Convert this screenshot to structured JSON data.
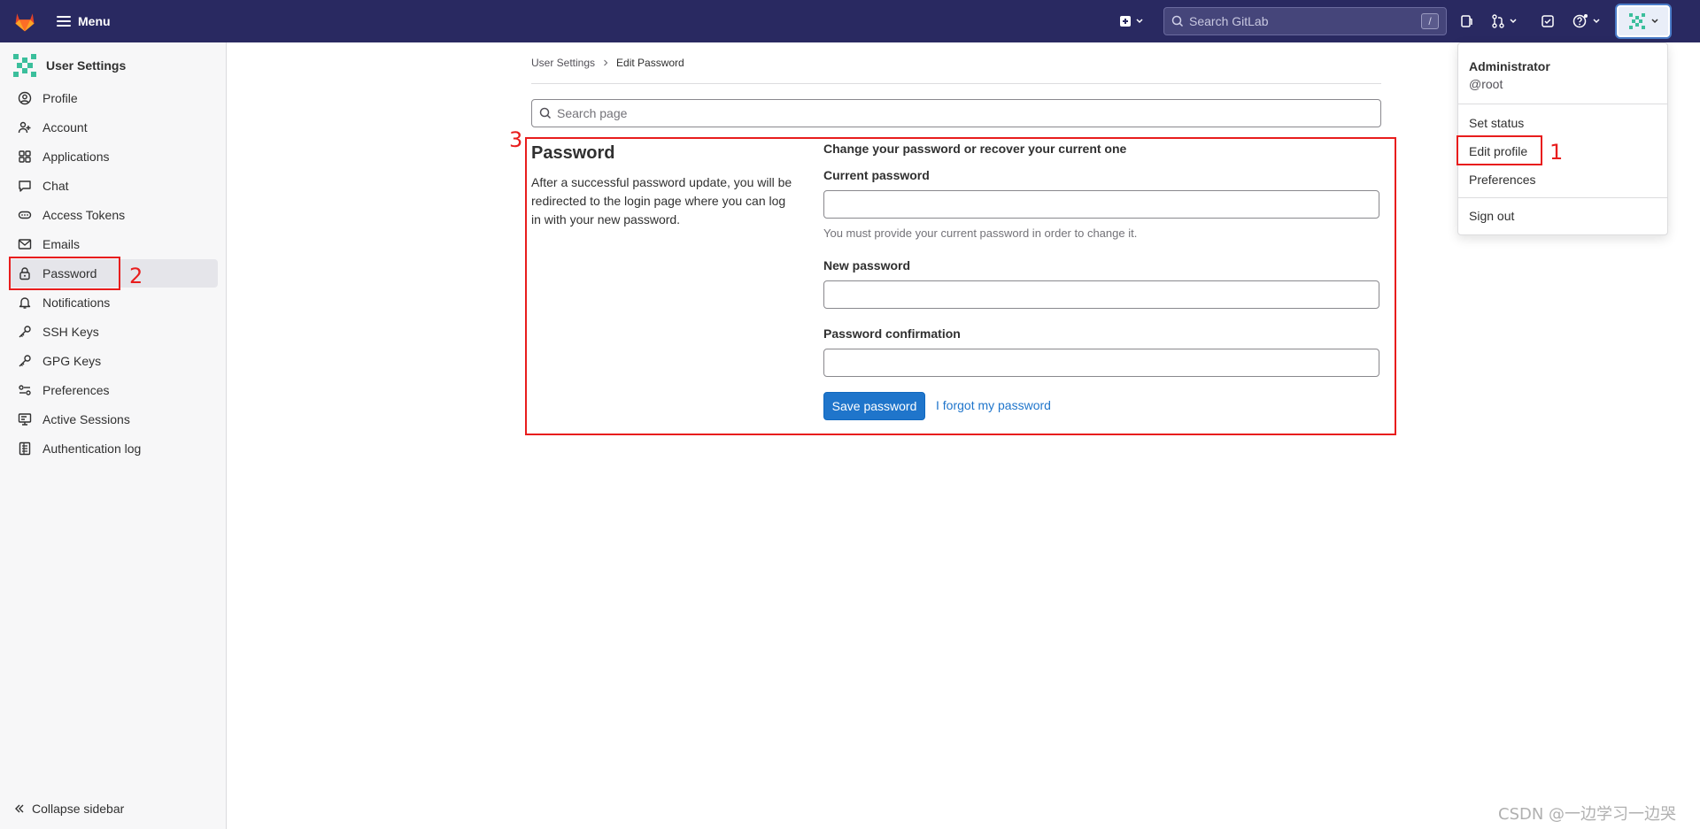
{
  "topbar": {
    "menu_label": "Menu",
    "search_placeholder": "Search GitLab",
    "search_shortcut": "/"
  },
  "sidebar": {
    "title": "User Settings",
    "items": [
      {
        "label": "Profile",
        "icon": "user-icon"
      },
      {
        "label": "Account",
        "icon": "account-icon"
      },
      {
        "label": "Applications",
        "icon": "applications-icon"
      },
      {
        "label": "Chat",
        "icon": "chat-icon"
      },
      {
        "label": "Access Tokens",
        "icon": "token-icon"
      },
      {
        "label": "Emails",
        "icon": "mail-icon"
      },
      {
        "label": "Password",
        "icon": "lock-icon",
        "active": true
      },
      {
        "label": "Notifications",
        "icon": "bell-icon"
      },
      {
        "label": "SSH Keys",
        "icon": "key-icon"
      },
      {
        "label": "GPG Keys",
        "icon": "key-icon"
      },
      {
        "label": "Preferences",
        "icon": "preferences-icon"
      },
      {
        "label": "Active Sessions",
        "icon": "monitor-icon"
      },
      {
        "label": "Authentication log",
        "icon": "log-icon"
      }
    ],
    "collapse_label": "Collapse sidebar"
  },
  "breadcrumb": {
    "parent": "User Settings",
    "current": "Edit Password"
  },
  "page_search": {
    "placeholder": "Search page"
  },
  "password_section": {
    "title": "Password",
    "description": "After a successful password update, you will be redirected to the login page where you can log in with your new password.",
    "form_heading": "Change your password or recover your current one",
    "current_label": "Current password",
    "current_help": "You must provide your current password in order to change it.",
    "new_label": "New password",
    "confirm_label": "Password confirmation",
    "save_label": "Save password",
    "forgot_label": "I forgot my password"
  },
  "user_dropdown": {
    "name": "Administrator",
    "username": "@root",
    "items": [
      "Set status",
      "Edit profile",
      "Preferences",
      "Sign out"
    ]
  },
  "annotations": [
    "1",
    "2",
    "3"
  ],
  "watermark": "CSDN @一边学习一边哭",
  "colors": {
    "topbar": "#292961",
    "accent": "#1f75cb",
    "annotation": "#e81d1d"
  }
}
